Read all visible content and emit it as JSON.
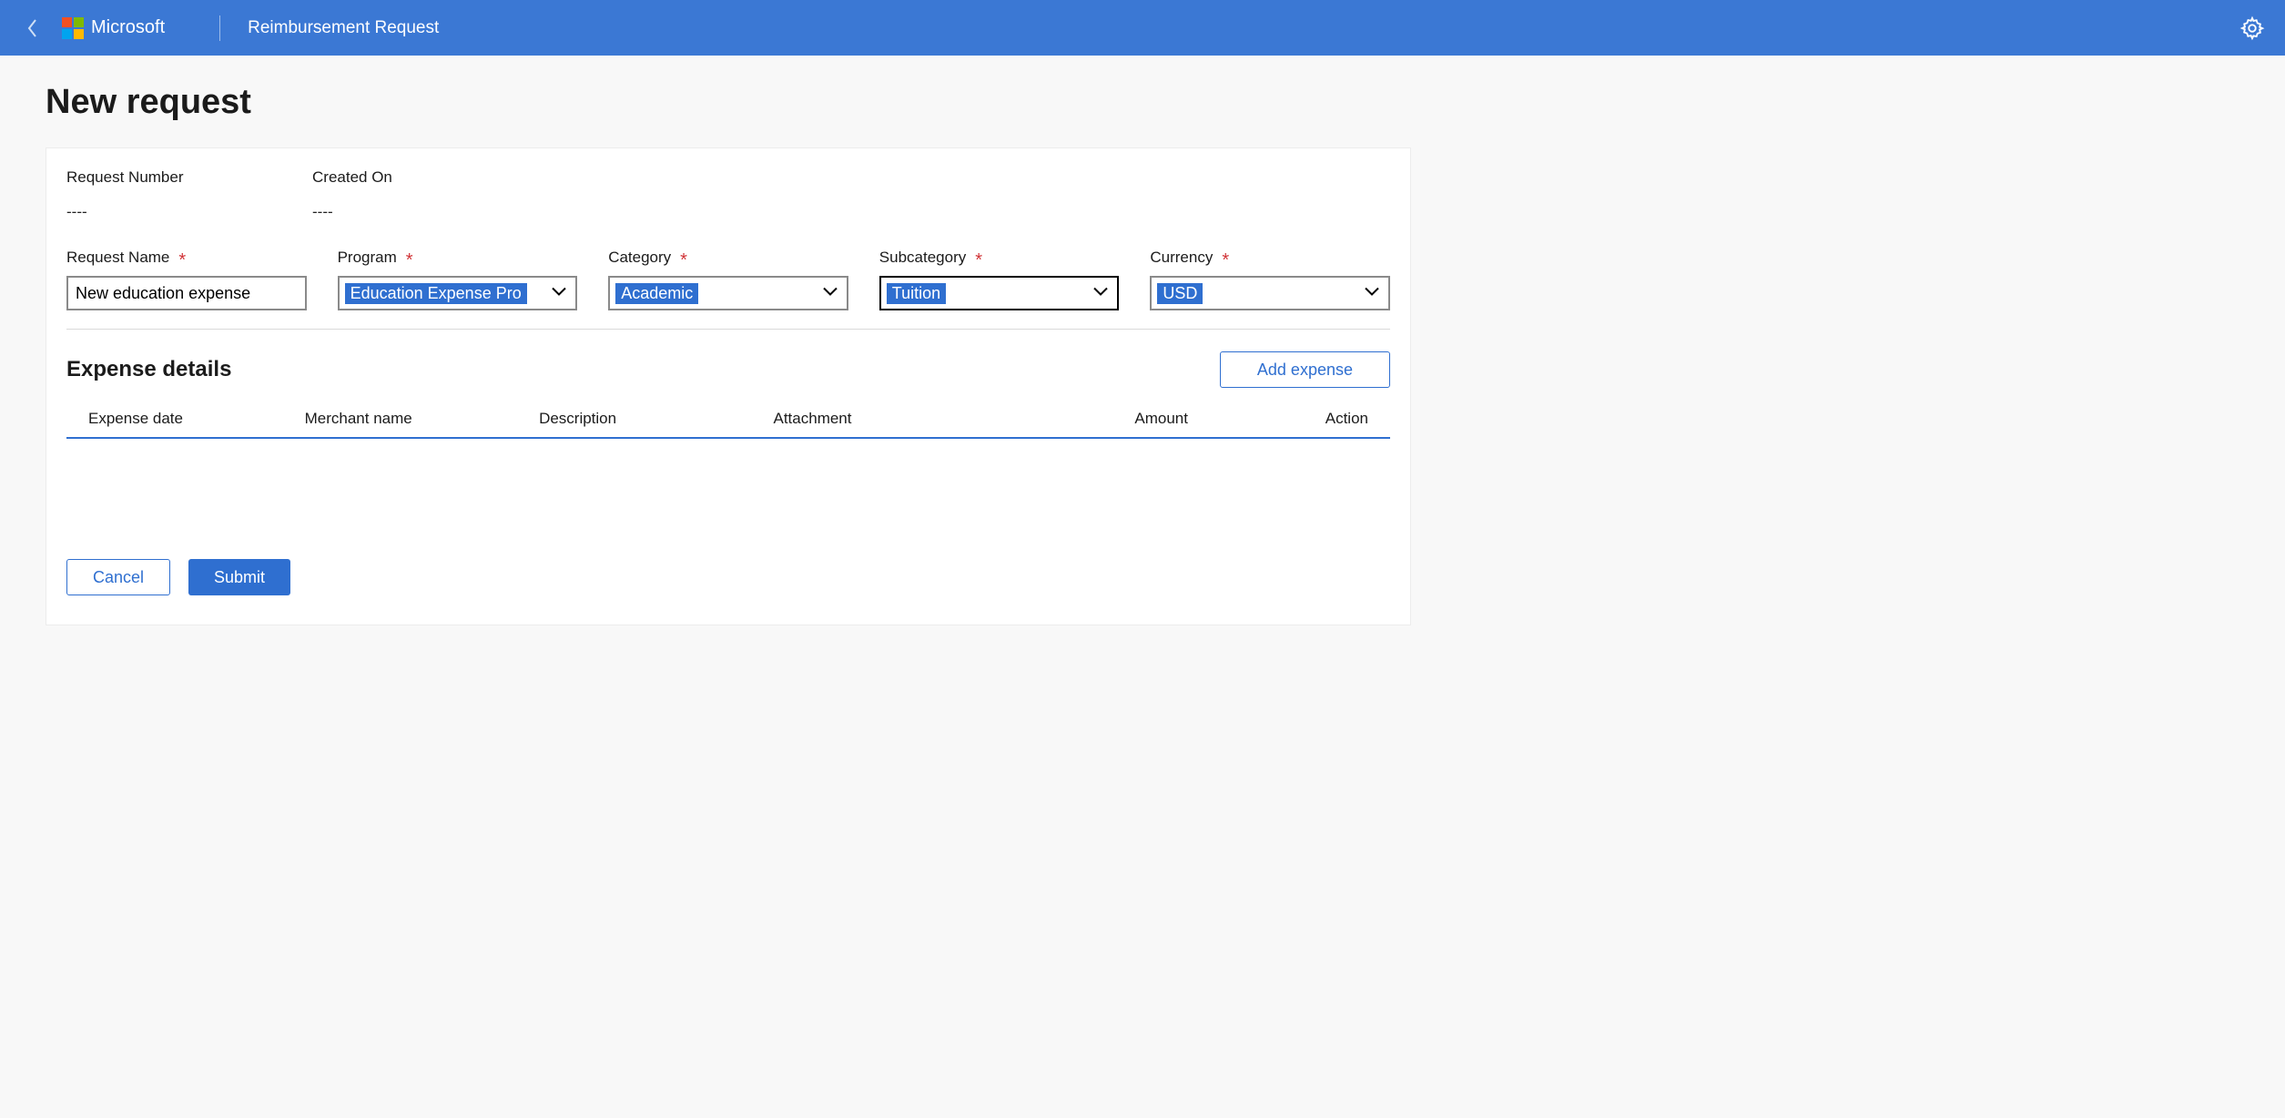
{
  "header": {
    "brand": "Microsoft",
    "app_title": "Reimbursement Request"
  },
  "page": {
    "title": "New request"
  },
  "meta": {
    "request_number_label": "Request Number",
    "request_number_value": "----",
    "created_on_label": "Created On",
    "created_on_value": "----"
  },
  "form": {
    "request_name": {
      "label": "Request Name",
      "value": "New education expense"
    },
    "program": {
      "label": "Program",
      "value": "Education Expense Pro"
    },
    "category": {
      "label": "Category",
      "value": "Academic"
    },
    "subcategory": {
      "label": "Subcategory",
      "value": "Tuition"
    },
    "currency": {
      "label": "Currency",
      "value": "USD"
    }
  },
  "details": {
    "title": "Expense details",
    "add_button": "Add expense",
    "columns": {
      "date": "Expense date",
      "merchant": "Merchant name",
      "description": "Description",
      "attachment": "Attachment",
      "amount": "Amount",
      "action": "Action"
    }
  },
  "actions": {
    "cancel": "Cancel",
    "submit": "Submit"
  }
}
